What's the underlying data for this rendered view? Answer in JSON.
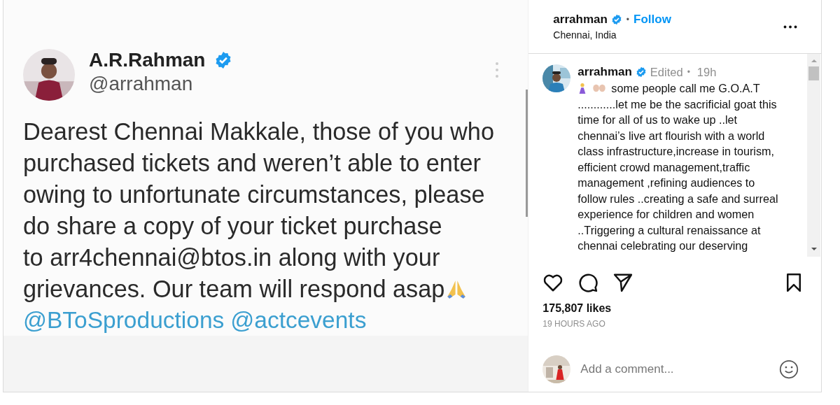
{
  "post_image": {
    "author_name": "A.R.Rahman",
    "verified": true,
    "author_handle": "@arrahman",
    "body_lines": [
      "Dearest Chennai Makkale, those of you who",
      "purchased tickets and weren’t able to enter",
      "owing to unfortunate circumstances, please",
      "do share a copy of your ticket purchase",
      "to arr4chennai@btos.in along with your"
    ],
    "closing_line": "grievances. Our team will respond asap",
    "mentions": [
      "@BToSproductions",
      "@actcevents"
    ]
  },
  "header": {
    "username": "arrahman",
    "verified": true,
    "separator": "•",
    "follow": "Follow",
    "location": "Chennai, India"
  },
  "caption": {
    "username": "arrahman",
    "verified": true,
    "edited": "Edited",
    "separator": "•",
    "time": "19h",
    "first_line": "some people call me G.O.A.T",
    "lines": [
      "............let me be the sacrificial goat this",
      "time for all of us to wake up ..let",
      "chennai’s live art flourish with a world",
      "class infrastructure,increase in tourism,",
      "efficient crowd management,traffic",
      "management ,refining audiences to",
      "follow rules ..creating a safe and surreal",
      "experience for children and women",
      "..Triggering a cultural renaissance at",
      "chennai celebrating our deserving"
    ]
  },
  "likes": "175,807 likes",
  "posted": "19 HOURS AGO",
  "comment": {
    "placeholder": "Add a comment..."
  }
}
